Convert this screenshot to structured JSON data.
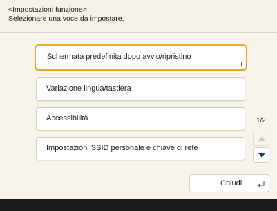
{
  "header": {
    "title": "<Impostazioni funzione>",
    "subtitle": "Selezionare una voce da impostare."
  },
  "menu": {
    "items": [
      {
        "label": "Schermata predefinita dopo avvio/ripristino"
      },
      {
        "label": "Variazione lingua/tastiera"
      },
      {
        "label": "Accessibilità"
      },
      {
        "label": "Impostazioni SSID personale e chiave di rete"
      }
    ]
  },
  "pagination": {
    "indicator": "1/2"
  },
  "footer": {
    "close_label": "Chiudi"
  },
  "icons": {
    "scroll_up": "triangle-up-icon",
    "scroll_down": "triangle-down-icon",
    "enter": "enter-icon"
  },
  "colors": {
    "selection_border": "#f0a52c",
    "background": "#f4f1e7"
  }
}
